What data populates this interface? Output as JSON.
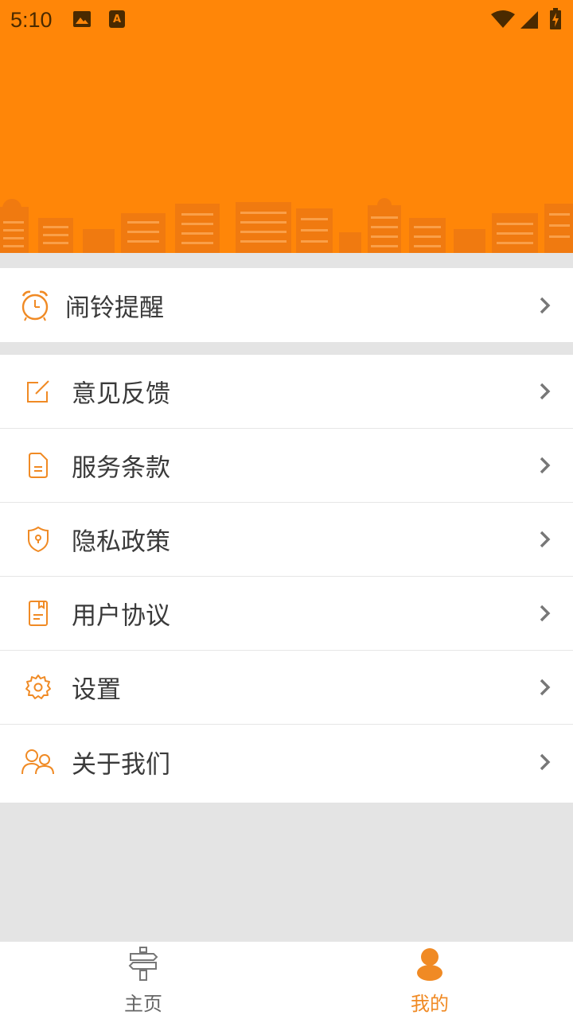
{
  "status_bar": {
    "time": "5:10",
    "left_icons": [
      "image-icon",
      "a-notification-icon"
    ],
    "right_icons": [
      "wifi-icon",
      "signal-icon",
      "battery-charging-icon"
    ]
  },
  "header": {
    "background": "#ff8608",
    "illustration": "city-skyline"
  },
  "alarm_section": {
    "items": [
      {
        "label": "闹铃提醒",
        "icon": "alarm-clock-icon"
      }
    ]
  },
  "menu": {
    "items": [
      {
        "label": "意见反馈",
        "icon": "edit-icon"
      },
      {
        "label": "服务条款",
        "icon": "document-icon"
      },
      {
        "label": "隐私政策",
        "icon": "shield-icon"
      },
      {
        "label": "用户协议",
        "icon": "bookmark-doc-icon"
      },
      {
        "label": "设置",
        "icon": "gear-icon"
      },
      {
        "label": "关于我们",
        "icon": "users-icon"
      }
    ]
  },
  "tab_bar": {
    "tabs": [
      {
        "label": "主页",
        "icon": "signpost-icon",
        "active": false
      },
      {
        "label": "我的",
        "icon": "person-icon",
        "active": true
      }
    ]
  },
  "colors": {
    "accent": "#ff8608",
    "icon_orange": "#f08a24",
    "chevron": "#777777",
    "inactive_tab": "#666666"
  }
}
